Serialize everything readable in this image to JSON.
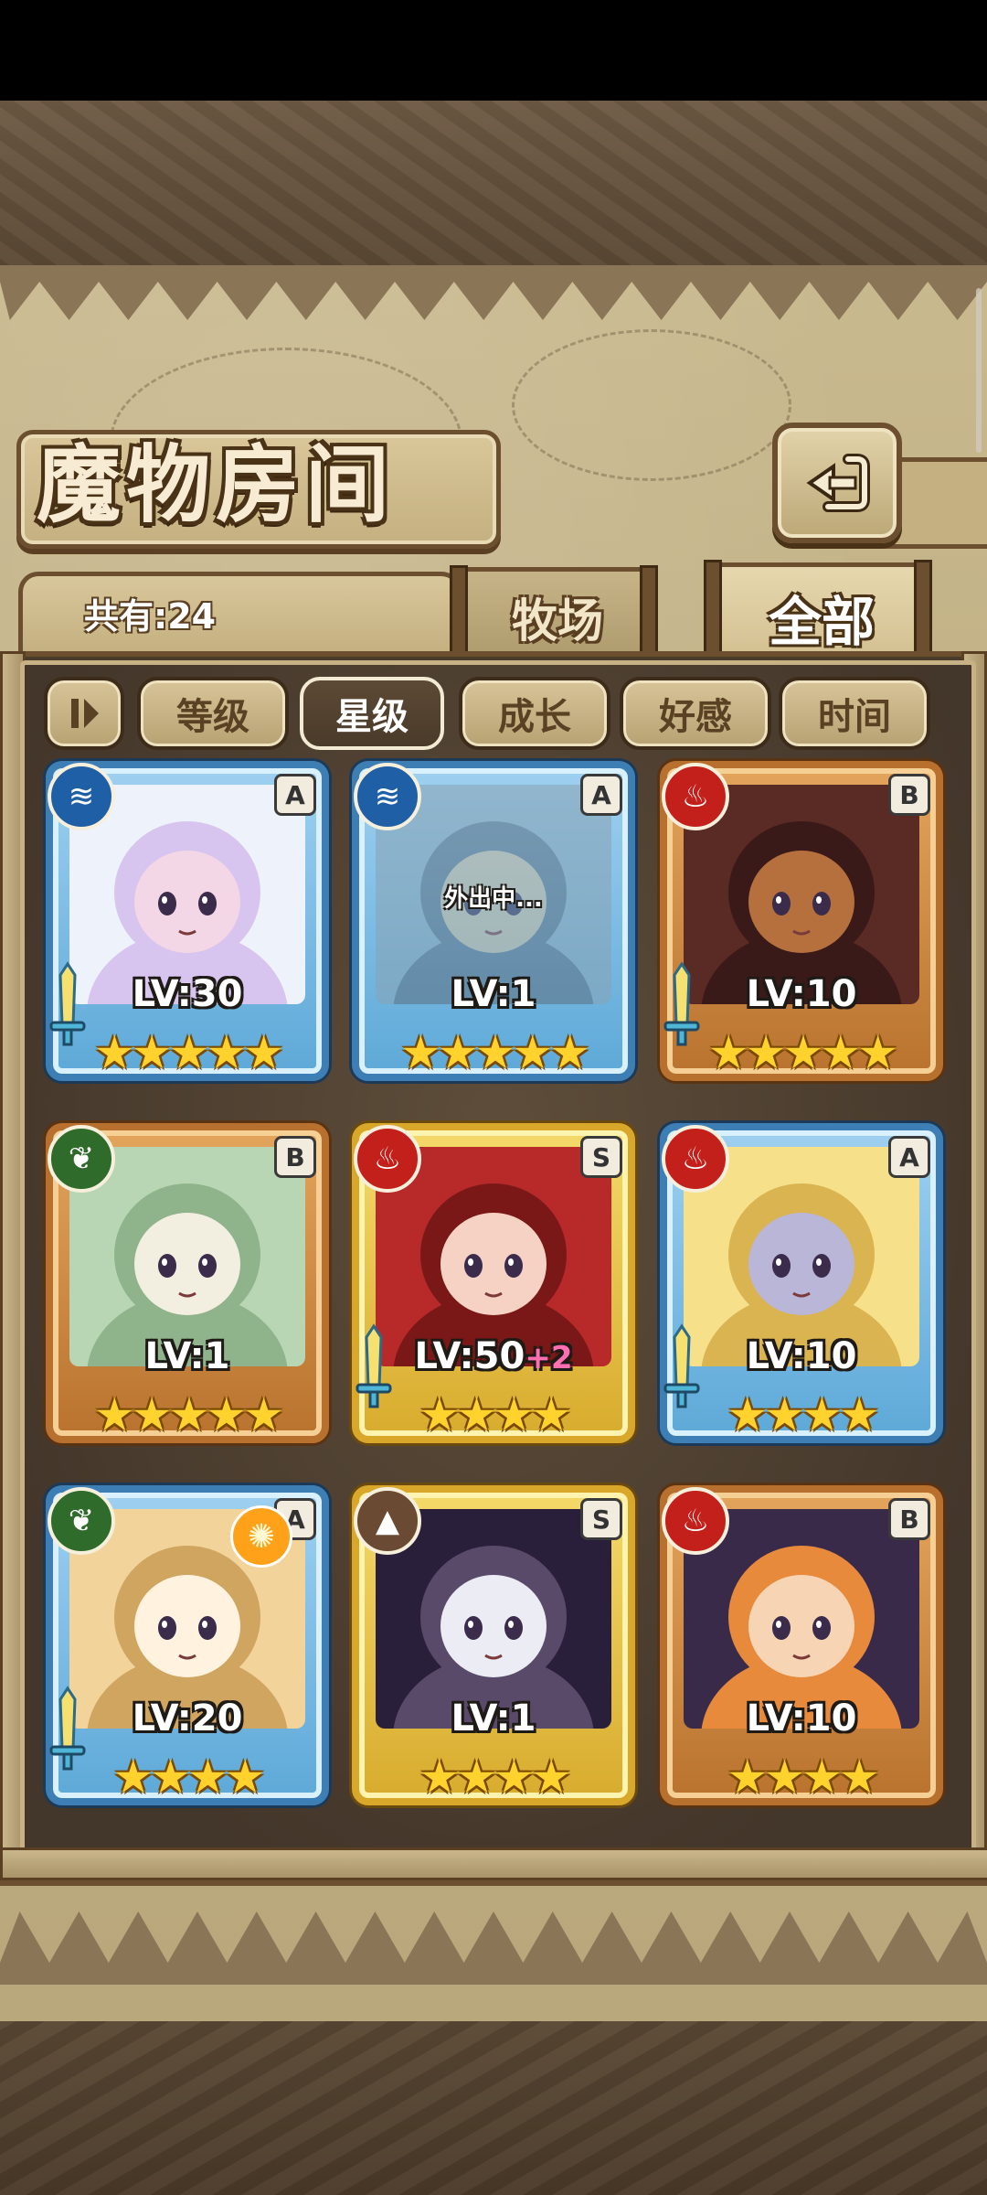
{
  "title": "魔物房间",
  "count_label": "共有:24",
  "tabs": {
    "ranch": "牧场",
    "all": "全部"
  },
  "filters": [
    {
      "label": "等级",
      "active": false
    },
    {
      "label": "星级",
      "active": true
    },
    {
      "label": "成长",
      "active": false
    },
    {
      "label": "好感",
      "active": false
    },
    {
      "label": "时间",
      "active": false
    }
  ],
  "monsters": [
    {
      "element": "water",
      "rank": "A",
      "level": "LV:30",
      "stars": 5,
      "frame": "blue",
      "weapon": true
    },
    {
      "element": "water",
      "rank": "A",
      "level": "LV:1",
      "stars": 5,
      "frame": "blue",
      "weapon": false,
      "status": "外出中..."
    },
    {
      "element": "fire",
      "rank": "B",
      "level": "LV:10",
      "stars": 5,
      "frame": "bronze",
      "weapon": true
    },
    {
      "element": "grass",
      "rank": "B",
      "level": "LV:1",
      "stars": 5,
      "frame": "bronze",
      "weapon": false
    },
    {
      "element": "fire",
      "rank": "S",
      "level": "LV:50",
      "bonus": "+2",
      "stars": 4,
      "frame": "gold",
      "weapon": true
    },
    {
      "element": "fire",
      "rank": "A",
      "level": "LV:10",
      "stars": 4,
      "frame": "blue",
      "weapon": true
    },
    {
      "element": "grass",
      "rank": "A",
      "level": "LV:20",
      "stars": 4,
      "frame": "blue",
      "weapon": true,
      "badge": "orange"
    },
    {
      "element": "earth",
      "rank": "S",
      "level": "LV:1",
      "stars": 4,
      "frame": "gold",
      "weapon": false
    },
    {
      "element": "fire",
      "rank": "B",
      "level": "LV:10",
      "stars": 4,
      "frame": "bronze",
      "weapon": false
    }
  ],
  "star_glyph": "★",
  "element_glyphs": {
    "water": "≋",
    "fire": "♨",
    "grass": "❦",
    "earth": "▲"
  },
  "colors": {
    "blue_frame": "#3d7fb5",
    "gold_frame": "#d9a82a",
    "bronze_frame": "#b8702e",
    "star": "#ffd22e"
  }
}
